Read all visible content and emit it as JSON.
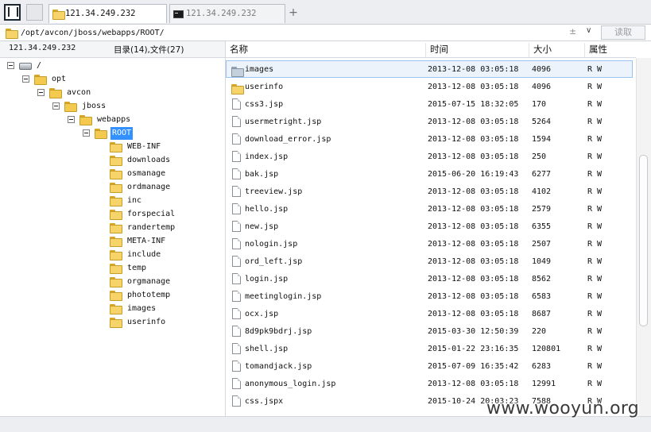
{
  "tabs": [
    {
      "label": "121.34.249.232",
      "icon": "folder-icon",
      "active": true
    },
    {
      "label": "121.34.249.232",
      "icon": "terminal-icon",
      "active": false
    }
  ],
  "address": {
    "path": "/opt/avcon/jboss/webapps/ROOT/",
    "extra": "±",
    "dropdown": "∨",
    "read_label": "读取"
  },
  "left_header": {
    "host": "121.34.249.232",
    "count": "目录(14),文件(27)"
  },
  "tree": [
    {
      "label": "/",
      "type": "drive",
      "toggle": true,
      "depth": 0
    },
    {
      "label": "opt",
      "type": "folder",
      "toggle": true,
      "depth": 1
    },
    {
      "label": "avcon",
      "type": "folder",
      "toggle": true,
      "depth": 2
    },
    {
      "label": "jboss",
      "type": "folder",
      "toggle": true,
      "depth": 3
    },
    {
      "label": "webapps",
      "type": "folder",
      "toggle": true,
      "depth": 4
    },
    {
      "label": "ROOT",
      "type": "folder",
      "toggle": true,
      "depth": 5,
      "selected": true
    },
    {
      "label": "WEB-INF",
      "type": "folder",
      "toggle": false,
      "depth": 6
    },
    {
      "label": "downloads",
      "type": "folder",
      "toggle": false,
      "depth": 6
    },
    {
      "label": "osmanage",
      "type": "folder",
      "toggle": false,
      "depth": 6
    },
    {
      "label": "ordmanage",
      "type": "folder",
      "toggle": false,
      "depth": 6
    },
    {
      "label": "inc",
      "type": "folder",
      "toggle": false,
      "depth": 6
    },
    {
      "label": "forspecial",
      "type": "folder",
      "toggle": false,
      "depth": 6
    },
    {
      "label": "randertemp",
      "type": "folder",
      "toggle": false,
      "depth": 6
    },
    {
      "label": "META-INF",
      "type": "folder",
      "toggle": false,
      "depth": 6
    },
    {
      "label": "include",
      "type": "folder",
      "toggle": false,
      "depth": 6
    },
    {
      "label": "temp",
      "type": "folder",
      "toggle": false,
      "depth": 6
    },
    {
      "label": "orgmanage",
      "type": "folder",
      "toggle": false,
      "depth": 6
    },
    {
      "label": "phototemp",
      "type": "folder",
      "toggle": false,
      "depth": 6
    },
    {
      "label": "images",
      "type": "folder",
      "toggle": false,
      "depth": 6
    },
    {
      "label": "userinfo",
      "type": "folder",
      "toggle": false,
      "depth": 6
    }
  ],
  "columns": {
    "name": "名称",
    "time": "时间",
    "size": "大小",
    "attr": "属性"
  },
  "files": [
    {
      "name": "images",
      "type": "folder-grey",
      "time": "2013-12-08 03:05:18",
      "size": "4096",
      "attr": "R W",
      "selected": true
    },
    {
      "name": "userinfo",
      "type": "folder",
      "time": "2013-12-08 03:05:18",
      "size": "4096",
      "attr": "R W"
    },
    {
      "name": "css3.jsp",
      "type": "file",
      "time": "2015-07-15 18:32:05",
      "size": "170",
      "attr": "R W"
    },
    {
      "name": "usermetright.jsp",
      "type": "file",
      "time": "2013-12-08 03:05:18",
      "size": "5264",
      "attr": "R W"
    },
    {
      "name": "download_error.jsp",
      "type": "file",
      "time": "2013-12-08 03:05:18",
      "size": "1594",
      "attr": "R W"
    },
    {
      "name": "index.jsp",
      "type": "file",
      "time": "2013-12-08 03:05:18",
      "size": "250",
      "attr": "R W"
    },
    {
      "name": "bak.jsp",
      "type": "file",
      "time": "2015-06-20 16:19:43",
      "size": "6277",
      "attr": "R W"
    },
    {
      "name": "treeview.jsp",
      "type": "file",
      "time": "2013-12-08 03:05:18",
      "size": "4102",
      "attr": "R W"
    },
    {
      "name": "hello.jsp",
      "type": "file",
      "time": "2013-12-08 03:05:18",
      "size": "2579",
      "attr": "R W"
    },
    {
      "name": "new.jsp",
      "type": "file",
      "time": "2013-12-08 03:05:18",
      "size": "6355",
      "attr": "R W"
    },
    {
      "name": "nologin.jsp",
      "type": "file",
      "time": "2013-12-08 03:05:18",
      "size": "2507",
      "attr": "R W"
    },
    {
      "name": "ord_left.jsp",
      "type": "file",
      "time": "2013-12-08 03:05:18",
      "size": "1049",
      "attr": "R W"
    },
    {
      "name": "login.jsp",
      "type": "file",
      "time": "2013-12-08 03:05:18",
      "size": "8562",
      "attr": "R W"
    },
    {
      "name": "meetinglogin.jsp",
      "type": "file",
      "time": "2013-12-08 03:05:18",
      "size": "6583",
      "attr": "R W"
    },
    {
      "name": "ocx.jsp",
      "type": "file",
      "time": "2013-12-08 03:05:18",
      "size": "8687",
      "attr": "R W"
    },
    {
      "name": "8d9pk9bdrj.jsp",
      "type": "file",
      "time": "2015-03-30 12:50:39",
      "size": "220",
      "attr": "R W"
    },
    {
      "name": "shell.jsp",
      "type": "file",
      "time": "2015-01-22 23:16:35",
      "size": "120801",
      "attr": "R W"
    },
    {
      "name": "tomandjack.jsp",
      "type": "file",
      "time": "2015-07-09 16:35:42",
      "size": "6283",
      "attr": "R W"
    },
    {
      "name": "anonymous_login.jsp",
      "type": "file",
      "time": "2013-12-08 03:05:18",
      "size": "12991",
      "attr": "R W"
    },
    {
      "name": "css.jspx",
      "type": "file",
      "time": "2015-10-24 20:03:23",
      "size": "7588",
      "attr": "R W"
    }
  ],
  "watermark": "www.wooyun.org"
}
